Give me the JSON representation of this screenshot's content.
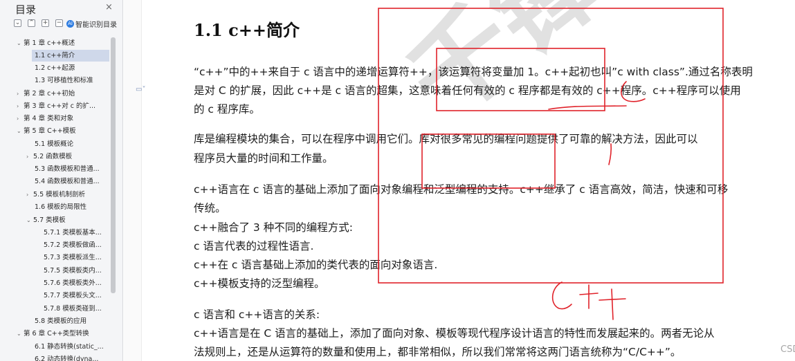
{
  "sidebar": {
    "title": "目录",
    "close": "×",
    "toolbar": {
      "smart_label": "智能识别目录",
      "smart_glyph": "AI"
    },
    "items": [
      {
        "label": "第 1 章    c++概述",
        "arrow": "⌄"
      },
      {
        "label": "1.1 c++简介",
        "arrow": ""
      },
      {
        "label": "1.2 c++起源",
        "arrow": ""
      },
      {
        "label": "1.3 可移植性和标准",
        "arrow": ""
      },
      {
        "label": "第 2 章    c++初始",
        "arrow": "›"
      },
      {
        "label": "第 3 章    c++对 c 的扩...",
        "arrow": "›"
      },
      {
        "label": "第 4 章    类和对象",
        "arrow": "›"
      },
      {
        "label": "第 5 章    C++模板",
        "arrow": "⌄"
      },
      {
        "label": "5.1 模板概论",
        "arrow": ""
      },
      {
        "label": "5.2 函数模板",
        "arrow": "›"
      },
      {
        "label": "5.3 函数模板和普通...",
        "arrow": ""
      },
      {
        "label": "5.4 函数模板和普通...",
        "arrow": ""
      },
      {
        "label": "5.5 模板机制剖析",
        "arrow": "›"
      },
      {
        "label": "1.6 模板的局限性",
        "arrow": ""
      },
      {
        "label": "5.7 类模板",
        "arrow": "⌄"
      },
      {
        "label": "5.7.1 类模板基本...",
        "arrow": ""
      },
      {
        "label": "5.7.2 类模板做函...",
        "arrow": ""
      },
      {
        "label": "5.7.3 类模板派生...",
        "arrow": ""
      },
      {
        "label": "5.7.5 类模板类内...",
        "arrow": ""
      },
      {
        "label": "5.7.6 类模板类外...",
        "arrow": ""
      },
      {
        "label": "5.7.7 类模板头文...",
        "arrow": ""
      },
      {
        "label": "5.7.8 模板类碰到...",
        "arrow": ""
      },
      {
        "label": "5.8 类模板的应用",
        "arrow": ""
      },
      {
        "label": "第 6 章    C++类型转换",
        "arrow": "⌄"
      },
      {
        "label": "6.1 静态转换(static_...",
        "arrow": ""
      },
      {
        "label": "6.2 动态转换(dyna...",
        "arrow": ""
      }
    ]
  },
  "document": {
    "title": "1.1 c++简介",
    "paragraphs": [
      "“c++”中的++来自于 c 语言中的递增运算符++，该运算符将变量加 1。c++起初也叫”c with class”.通过名称表明",
      "是对 C 的扩展，因此 c++是 c 语言的超集，这意味着任何有效的 c 程序都是有效的 c++程序。c++程序可以使用",
      "的 c 程序库。",
      "库是编程模块的集合，可以在程序中调用它们。库对很多常见的编程问题提供了可靠的解决方法，因此可以",
      "程序员大量的时间和工作量。",
      "c++语言在 c 语言的基础上添加了面向对象编程和泛型编程的支持。c++继承了 c 语言高效，简洁，快速和可移",
      "传统。",
      "c++融合了 3 种不同的编程方式:",
      "c 语言代表的过程性语言.",
      "c++在 c 语言基础上添加的类代表的面向对象语言.",
      "c++模板支持的泛型编程。",
      "c 语言和 c++语言的关系:",
      "c++语言是在 C 语言的基础上，添加了面向对象、模板等现代程序设计语言的特性而发展起来的。两者无论从",
      "法规则上，还是从运算符的数量和使用上，都非常相似，所以我们常常将这两门语言统称为“C/C++”。"
    ],
    "watermark": "千锋教育",
    "csdn_mark": "CSDN @知识分享小能手",
    "annotation_color": "#e0222a"
  }
}
